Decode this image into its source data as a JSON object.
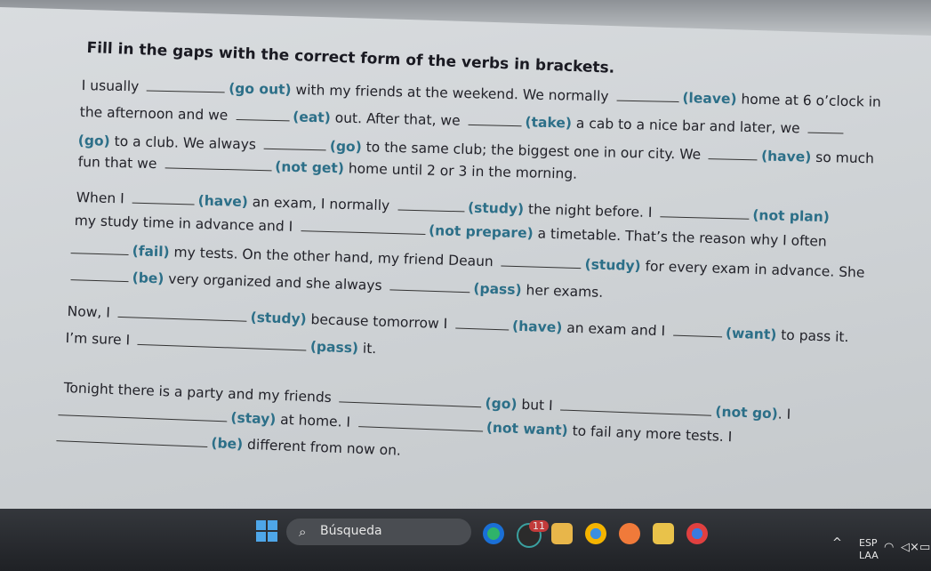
{
  "title": "Fill in the gaps with the correct form of the verbs in brackets.",
  "lines": [
    [
      {
        "t": "I usually "
      },
      {
        "g": 88
      },
      {
        "v": "(go out)"
      },
      {
        "t": " with my friends at the weekend. We normally "
      },
      {
        "g": 70
      },
      {
        "v": "(leave)"
      },
      {
        "t": " home at 6 o’clock in"
      }
    ],
    [
      {
        "t": "the afternoon and we "
      },
      {
        "g": 60
      },
      {
        "v": "(eat)"
      },
      {
        "t": " out. After that, we "
      },
      {
        "g": 60
      },
      {
        "v": "(take)"
      },
      {
        "t": " a cab to a nice bar and later, we "
      },
      {
        "g": 40
      }
    ],
    [
      {
        "v": "(go)"
      },
      {
        "t": " to a club. We always "
      },
      {
        "g": 70
      },
      {
        "v": "(go)"
      },
      {
        "t": " to the same club; the biggest one in our city. We "
      },
      {
        "g": 55
      },
      {
        "v": "(have)"
      },
      {
        "t": " so much"
      }
    ],
    [
      {
        "t": "fun that we "
      },
      {
        "g": 120
      },
      {
        "v": "(not get)"
      },
      {
        "t": " home until 2 or 3 in the morning."
      }
    ],
    [
      {
        "t": "When I "
      },
      {
        "g": 70
      },
      {
        "v": "(have)"
      },
      {
        "t": " an exam, I normally "
      },
      {
        "g": 75
      },
      {
        "v": "(study)"
      },
      {
        "t": " the night before. I "
      },
      {
        "g": 100
      },
      {
        "v": "(not plan)"
      }
    ],
    [
      {
        "t": "my study time in advance and I "
      },
      {
        "g": 140
      },
      {
        "v": "(not prepare)"
      },
      {
        "t": " a timetable. That’s the reason why I often"
      }
    ],
    [
      {
        "g": 65
      },
      {
        "v": "(fail)"
      },
      {
        "t": " my tests. On the other hand, my friend Deaun "
      },
      {
        "g": 90
      },
      {
        "v": "(study)"
      },
      {
        "t": " for every exam in advance. She"
      }
    ],
    [
      {
        "g": 65
      },
      {
        "v": "(be)"
      },
      {
        "t": " very organized and she always "
      },
      {
        "g": 90
      },
      {
        "v": "(pass)"
      },
      {
        "t": " her exams."
      }
    ],
    [
      {
        "t": "Now, I "
      },
      {
        "g": 145
      },
      {
        "v": "(study)"
      },
      {
        "t": " because tomorrow I "
      },
      {
        "g": 60
      },
      {
        "v": "(have)"
      },
      {
        "t": " an exam and I "
      },
      {
        "g": 55
      },
      {
        "v": "(want)"
      },
      {
        "t": " to pass it."
      }
    ],
    [
      {
        "t": "I’m sure I "
      },
      {
        "g": 190
      },
      {
        "v": "(pass)"
      },
      {
        "t": " it."
      }
    ],
    [
      {
        "t": "Tonight there is a party and my friends "
      },
      {
        "g": 160
      },
      {
        "v": "(go)"
      },
      {
        "t": " but I "
      },
      {
        "g": 170
      },
      {
        "v": "(not go)"
      },
      {
        "t": ". I"
      }
    ],
    [
      {
        "g": 190
      },
      {
        "v": "(stay)"
      },
      {
        "t": " at home. I "
      },
      {
        "g": 140
      },
      {
        "v": "(not want)"
      },
      {
        "t": " to fail any more tests. I"
      }
    ],
    [
      {
        "g": 170
      },
      {
        "v": "(be)"
      },
      {
        "t": " different from now on."
      }
    ]
  ],
  "taskbar": {
    "search_placeholder": "Búsqueda",
    "badge": "11",
    "lang_top": "ESP",
    "lang_bottom": "LAA"
  },
  "colors": {
    "verb": "#2c6f88",
    "text": "#222229",
    "taskbar": "#2a2c30",
    "start": "#4ea6e8"
  }
}
